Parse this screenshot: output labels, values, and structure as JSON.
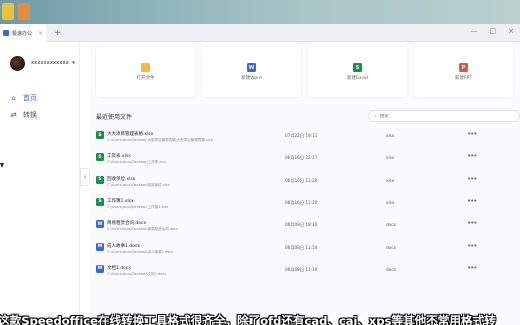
{
  "app": {
    "title": "极速办公",
    "tab_close": "×",
    "new_tab": "+",
    "window_controls": [
      "—",
      "□",
      "×"
    ]
  },
  "user": {
    "name": "xxxxxxxxxxxx",
    "caret": "▼"
  },
  "sidebar": {
    "items": [
      {
        "label": "首页",
        "icon": "home-icon",
        "glyph": "⌂"
      },
      {
        "label": "转换",
        "icon": "convert-icon",
        "glyph": "⇄"
      }
    ],
    "collapse_glyph": "‹"
  },
  "quick_actions": [
    {
      "label": "打开文件",
      "icon": "folder-icon",
      "glyph": "",
      "color": "#f5b941"
    },
    {
      "label": "新建Word",
      "icon": "word-icon",
      "glyph": "W",
      "color": "#3b67d8"
    },
    {
      "label": "新建Excel",
      "icon": "excel-icon",
      "glyph": "S",
      "color": "#1f8b4c"
    },
    {
      "label": "新建PPT",
      "icon": "ppt-icon",
      "glyph": "P",
      "color": "#e0573e"
    }
  ],
  "recent": {
    "title": "最近使用文件",
    "search_placeholder": "搜索",
    "files": [
      {
        "name": "大大项目管理表格.xlsx",
        "path": "C:\\Users\\asus\\Desktop\\大型项目管理表格\\大型项目管理表格.xlsx",
        "time": "07月22日 19:11",
        "type": "xlsx",
        "kind": "excel"
      },
      {
        "name": "工资表.xlsx",
        "path": "C:\\Users\\asus\\Desktop\\工资表.xlsx",
        "time": "06月16日 22:17",
        "type": "xlsx",
        "kind": "excel"
      },
      {
        "name": "回收单位.xlsx",
        "path": "C:\\Users\\asus\\Desktop\\回收单位.xlsx",
        "time": "06月16日 11:20",
        "type": "xlsx",
        "kind": "excel"
      },
      {
        "name": "工作簿1.xlsx",
        "path": "C:\\Users\\asus\\Desktop\\工作簿1.xlsx",
        "time": "06月16日 11:20",
        "type": "xlsx",
        "kind": "excel"
      },
      {
        "name": "简易租赁合同.docx",
        "path": "C:\\Users\\asus\\Desktop\\简易租赁合同.docx",
        "time": "06月09日 18:10",
        "type": "docx",
        "kind": "word"
      },
      {
        "name": "成人故事1.docx",
        "path": "C:\\Users\\asus\\Desktop\\成人故事1.docx",
        "time": "06月08日 11:54",
        "type": "docx",
        "kind": "word"
      },
      {
        "name": "文档1.docx",
        "path": "C:\\Users\\asus\\Desktop\\文档1.docx",
        "time": "06月08日 11:10",
        "type": "docx",
        "kind": "word"
      }
    ],
    "more_glyph": "•••"
  },
  "subtitle": "这款Speedoffice在线转换工具格式很齐全，除了ofd还有cad、caj、xps等其他不常用格式转"
}
